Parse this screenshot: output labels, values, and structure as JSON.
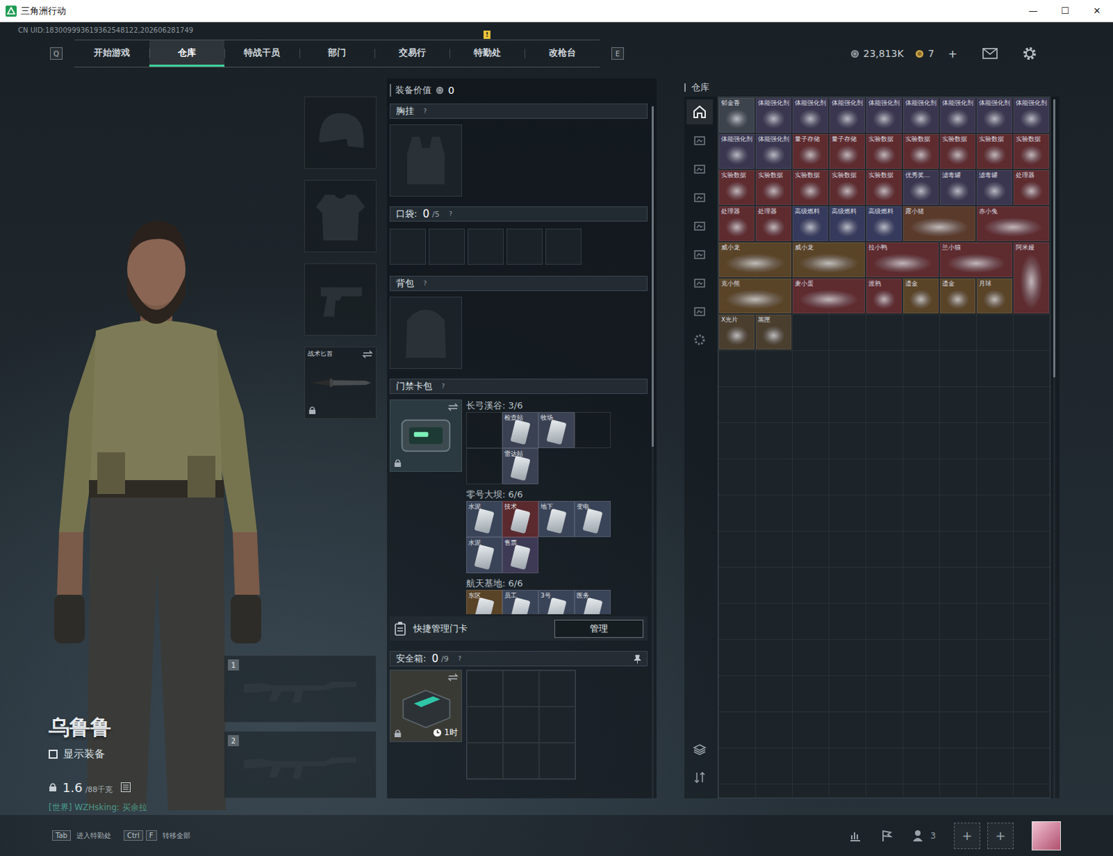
{
  "window": {
    "title": "三角洲行动",
    "controls": [
      "—",
      "☐",
      "✕"
    ]
  },
  "uid": "CN UID:183009993619362548122,202606281749",
  "nav": {
    "left_key": "Q",
    "right_key": "E",
    "tabs": [
      {
        "label": "开始游戏",
        "selected": false,
        "badge": ""
      },
      {
        "label": "仓库",
        "selected": true,
        "badge": ""
      },
      {
        "label": "特战干员",
        "selected": false,
        "badge": ""
      },
      {
        "label": "部门",
        "selected": false,
        "badge": ""
      },
      {
        "label": "交易行",
        "selected": false,
        "badge": ""
      },
      {
        "label": "特勤处",
        "selected": false,
        "badge": "!"
      },
      {
        "label": "改枪台",
        "selected": false,
        "badge": ""
      }
    ]
  },
  "currency": {
    "coins": "23,813K",
    "tickets": "7",
    "add": "+"
  },
  "character": {
    "name": "乌鲁鲁",
    "show_equipment": {
      "label": "显示装备",
      "checked": false
    },
    "weight": "1.6",
    "weight_max": "/88千克",
    "chat": "[世界] WZHsking: 买余拉"
  },
  "equip_slots": [
    {
      "kind": "helmet",
      "label": "",
      "locked": false,
      "swap": false
    },
    {
      "kind": "armor",
      "label": "",
      "locked": false,
      "swap": false
    },
    {
      "kind": "pistol",
      "label": "",
      "locked": false,
      "swap": false
    },
    {
      "kind": "knife",
      "label": "战术匕首",
      "locked": true,
      "swap": true
    }
  ],
  "weapon_slots": [
    {
      "number": "1"
    },
    {
      "number": "2"
    }
  ],
  "loadout": {
    "value_label": "装备价值",
    "value": "0",
    "chest": {
      "label": "胸挂",
      "help": "?"
    },
    "pocket": {
      "label": "口袋:",
      "used": "0",
      "capacity": "/5",
      "help": "?",
      "slots": 5
    },
    "backpack": {
      "label": "背包",
      "help": "?"
    },
    "keycards": {
      "label": "门禁卡包",
      "help": "?",
      "locked": true,
      "maps": [
        {
          "name": "长弓溪谷:",
          "count": "3/6",
          "slots": [
            {
              "label": "",
              "filled": false,
              "color": ""
            },
            {
              "label": "检查站",
              "filled": true,
              "color": "#3a4152"
            },
            {
              "label": "牧场",
              "filled": true,
              "color": "#3a4152"
            },
            {
              "label": "",
              "filled": false,
              "color": ""
            },
            {
              "label": "",
              "filled": false,
              "color": ""
            },
            {
              "label": "雷达站",
              "filled": true,
              "color": "#3a4152"
            }
          ]
        },
        {
          "name": "零号大坝:",
          "count": "6/6",
          "slots": [
            {
              "label": "水泥",
              "filled": true,
              "color": "#3a4458"
            },
            {
              "label": "技术",
              "filled": true,
              "color": "#5a2a2e"
            },
            {
              "label": "地下",
              "filled": true,
              "color": "#3a4458"
            },
            {
              "label": "变电",
              "filled": true,
              "color": "#3a4458"
            },
            {
              "label": "水泥",
              "filled": true,
              "color": "#3a4458"
            },
            {
              "label": "售票",
              "filled": true,
              "color": "#3e3a55"
            }
          ]
        },
        {
          "name": "航天基地:",
          "count": "6/6",
          "slots": [
            {
              "label": "东区",
              "filled": true,
              "color": "#5a4428"
            },
            {
              "label": "员工",
              "filled": true,
              "color": "#3a4458"
            },
            {
              "label": "3号",
              "filled": true,
              "color": "#3a4458"
            },
            {
              "label": "医务",
              "filled": true,
              "color": "#3a4458"
            }
          ]
        }
      ]
    },
    "quick_manage": {
      "label": "快捷管理门卡",
      "button": "管理"
    },
    "safe": {
      "label": "安全箱:",
      "used": "0",
      "capacity": "/9",
      "help": "?",
      "timer": "1时",
      "locked": true,
      "slots": 9
    }
  },
  "warehouse": {
    "title": "仓库",
    "sidebar": [
      {
        "selected": true
      },
      {
        "selected": false
      },
      {
        "selected": false
      },
      {
        "selected": false
      },
      {
        "selected": false
      },
      {
        "selected": false
      },
      {
        "selected": false
      },
      {
        "selected": false
      },
      {
        "selected": false
      }
    ],
    "items": [
      {
        "label": "郁金香",
        "kind": "single",
        "color": "#3d434c"
      },
      {
        "label": "体能强化剂",
        "kind": "single",
        "color": "#3a3650"
      },
      {
        "label": "体能强化剂",
        "kind": "single",
        "color": "#3a3650"
      },
      {
        "label": "体能强化剂",
        "kind": "single",
        "color": "#3a3650"
      },
      {
        "label": "体能强化剂",
        "kind": "single",
        "color": "#3a3650"
      },
      {
        "label": "体能强化剂",
        "kind": "single",
        "color": "#3a3650"
      },
      {
        "label": "体能强化剂",
        "kind": "single",
        "color": "#3a3650"
      },
      {
        "label": "体能强化剂",
        "kind": "single",
        "color": "#3a3650"
      },
      {
        "label": "体能强化剂",
        "kind": "single",
        "color": "#3a3650"
      },
      {
        "label": "体能强化剂",
        "kind": "single",
        "color": "#3a3650"
      },
      {
        "label": "体能强化剂",
        "kind": "single",
        "color": "#3a3650"
      },
      {
        "label": "量子存储",
        "kind": "single",
        "color": "#5e2b2f"
      },
      {
        "label": "量子存储",
        "kind": "single",
        "color": "#5e2b2f"
      },
      {
        "label": "实验数据",
        "kind": "single",
        "color": "#5e2b2f"
      },
      {
        "label": "实验数据",
        "kind": "single",
        "color": "#5e2b2f"
      },
      {
        "label": "实验数据",
        "kind": "single",
        "color": "#5e2b2f"
      },
      {
        "label": "实验数据",
        "kind": "single",
        "color": "#5e2b2f"
      },
      {
        "label": "实验数据",
        "kind": "single",
        "color": "#5e2b2f"
      },
      {
        "label": "实验数据",
        "kind": "single",
        "color": "#5e2b2f"
      },
      {
        "label": "实验数据",
        "kind": "single",
        "color": "#5e2b2f"
      },
      {
        "label": "实验数据",
        "kind": "single",
        "color": "#5e2b2f"
      },
      {
        "label": "实验数据",
        "kind": "single",
        "color": "#5e2b2f"
      },
      {
        "label": "实验数据",
        "kind": "single",
        "color": "#5e2b2f"
      },
      {
        "label": "优秀奖...",
        "kind": "single",
        "color": "#3a3650"
      },
      {
        "label": "滤毒罐",
        "kind": "single",
        "color": "#3a3650"
      },
      {
        "label": "滤毒罐",
        "kind": "single",
        "color": "#3a3650"
      },
      {
        "label": "处理器",
        "kind": "single",
        "color": "#5e2b2f"
      },
      {
        "label": "处理器",
        "kind": "single",
        "color": "#5e2b2f"
      },
      {
        "label": "处理器",
        "kind": "single",
        "color": "#5e2b2f"
      },
      {
        "label": "高级燃料",
        "kind": "single",
        "color": "#363a5c"
      },
      {
        "label": "高级燃料",
        "kind": "single",
        "color": "#363a5c"
      },
      {
        "label": "高级燃料",
        "kind": "single",
        "color": "#363a5c"
      },
      {
        "label": "露小猪",
        "kind": "wide",
        "color": "#5a3a2a"
      },
      {
        "label": "赤小兔",
        "kind": "wide",
        "color": "#5e2b2f"
      },
      {
        "label": "威小龙",
        "kind": "wide",
        "color": "#5a4428"
      },
      {
        "label": "威小龙",
        "kind": "wide",
        "color": "#5a4428"
      },
      {
        "label": "拉小鸭",
        "kind": "wide",
        "color": "#5e2b2f"
      },
      {
        "label": "兰小猫",
        "kind": "wide",
        "color": "#5e2b2f"
      },
      {
        "label": "阿米娅",
        "kind": "tall",
        "color": "#5e2b2f"
      },
      {
        "label": "克小熊",
        "kind": "wide",
        "color": "#5a4428"
      },
      {
        "label": "麦小蛋",
        "kind": "wide",
        "color": "#5e2b2f"
      },
      {
        "label": "渡鸦",
        "kind": "single",
        "color": "#5e2b2f"
      },
      {
        "label": "遗金",
        "kind": "single",
        "color": "#5a4428"
      },
      {
        "label": "遗金",
        "kind": "single",
        "color": "#5a4428"
      },
      {
        "label": "月球",
        "kind": "single",
        "color": "#5a4428"
      },
      {
        "label": "X光片",
        "kind": "single",
        "color": "#4a3e2e"
      },
      {
        "label": "黑匣",
        "kind": "single",
        "color": "#4a3e2e"
      }
    ]
  },
  "bottom_bar": {
    "hints": [
      {
        "keys": [
          "Tab"
        ],
        "label": "进入特勤处"
      },
      {
        "keys": [
          "Ctrl",
          "F"
        ],
        "label": "转移全部"
      }
    ],
    "friends": "3",
    "add_slots": [
      "+",
      "+"
    ]
  }
}
